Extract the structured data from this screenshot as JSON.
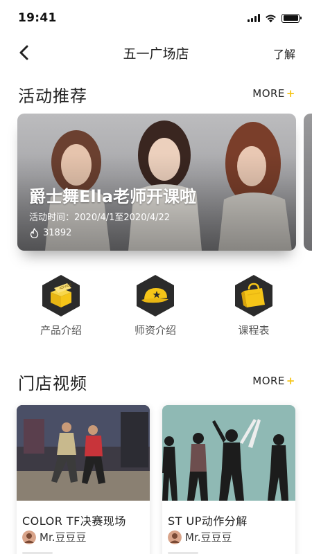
{
  "status_bar": {
    "time": "19:41"
  },
  "nav": {
    "title": "五一广场店",
    "action_label": "了解"
  },
  "activities": {
    "section_title": "活动推荐",
    "more_label": "MORE",
    "more_plus": "+",
    "banner": {
      "title": "爵士舞Ella老师开课啦",
      "date_text": "活动时间：2020/4/1至2020/4/22",
      "views": "31892"
    }
  },
  "features": [
    {
      "label": "产品介绍",
      "icon": "product-box-icon"
    },
    {
      "label": "师资介绍",
      "icon": "teacher-cap-icon"
    },
    {
      "label": "课程表",
      "icon": "schedule-bag-icon"
    }
  ],
  "videos": {
    "section_title": "门店视频",
    "more_label": "MORE",
    "more_plus": "+",
    "items": [
      {
        "title": "COLOR TF决赛现场",
        "author": "Mr.豆豆豆"
      },
      {
        "title": "ST UP动作分解",
        "author": "Mr.豆豆豆"
      }
    ]
  },
  "colors": {
    "accent": "#F5C518",
    "hexagon": "#2b2b2b",
    "text": "#222222"
  }
}
